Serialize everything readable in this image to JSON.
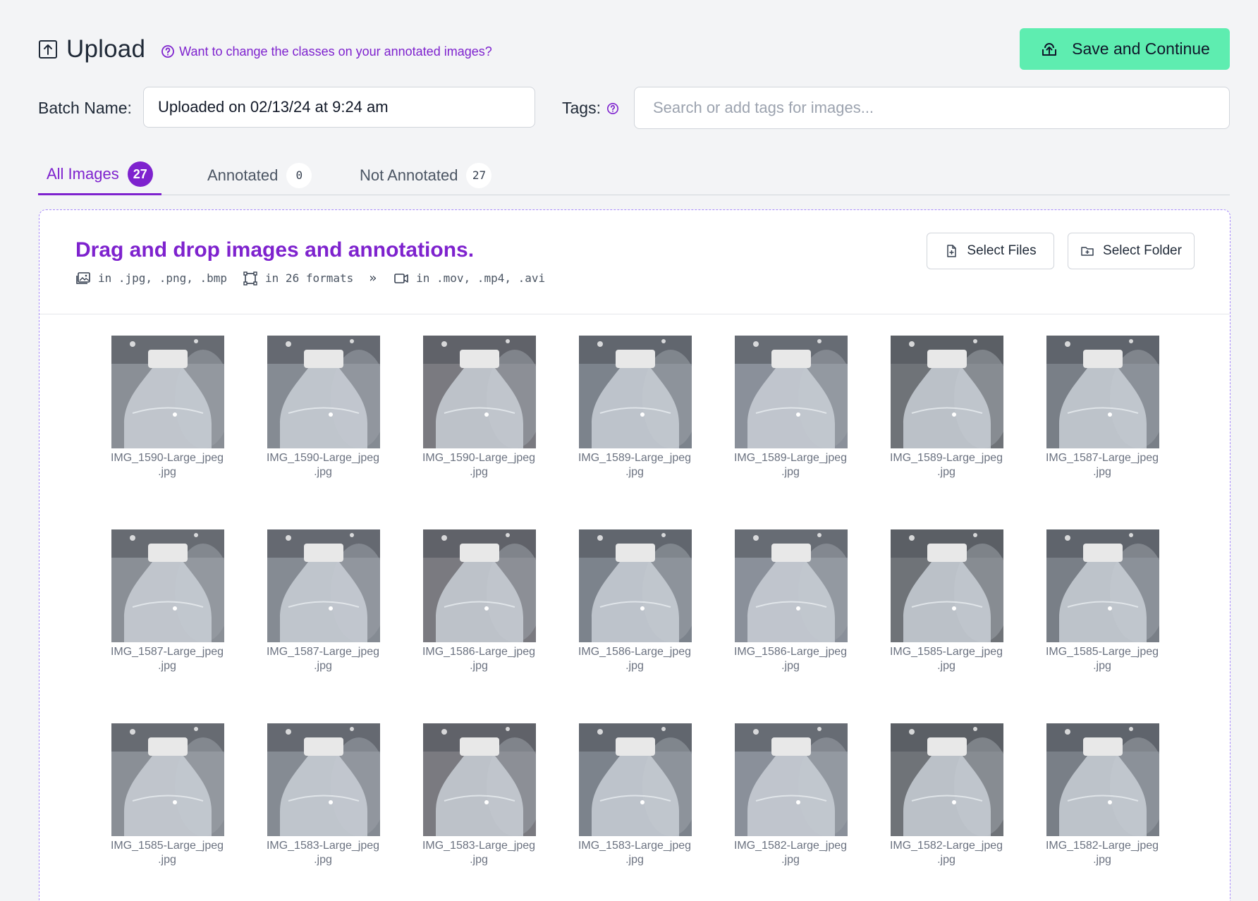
{
  "header": {
    "title": "Upload",
    "help_link": "Want to change the classes on your annotated images?",
    "save_button": "Save and Continue"
  },
  "batch": {
    "label": "Batch Name:",
    "value": "Uploaded on 02/13/24 at 9:24 am",
    "tags_label": "Tags:",
    "tags_placeholder": "Search or add tags for images..."
  },
  "tabs": [
    {
      "label": "All Images",
      "count": "27"
    },
    {
      "label": "Annotated",
      "count": "0"
    },
    {
      "label": "Not Annotated",
      "count": "27"
    }
  ],
  "dropzone": {
    "title": "Drag and drop images and annotations.",
    "formats": {
      "images": "in .jpg, .png, .bmp",
      "annotations": "in 26 formats",
      "videos": "in .mov, .mp4, .avi"
    },
    "select_files": "Select Files",
    "select_folder": "Select Folder"
  },
  "images": [
    {
      "name": "IMG_1590-Large_jpeg",
      "ext": ".jpg"
    },
    {
      "name": "IMG_1590-Large_jpeg",
      "ext": ".jpg"
    },
    {
      "name": "IMG_1590-Large_jpeg",
      "ext": ".jpg"
    },
    {
      "name": "IMG_1589-Large_jpeg",
      "ext": ".jpg"
    },
    {
      "name": "IMG_1589-Large_jpeg",
      "ext": ".jpg"
    },
    {
      "name": "IMG_1589-Large_jpeg",
      "ext": ".jpg"
    },
    {
      "name": "IMG_1587-Large_jpeg",
      "ext": ".jpg"
    },
    {
      "name": "IMG_1587-Large_jpeg",
      "ext": ".jpg"
    },
    {
      "name": "IMG_1587-Large_jpeg",
      "ext": ".jpg"
    },
    {
      "name": "IMG_1586-Large_jpeg",
      "ext": ".jpg"
    },
    {
      "name": "IMG_1586-Large_jpeg",
      "ext": ".jpg"
    },
    {
      "name": "IMG_1586-Large_jpeg",
      "ext": ".jpg"
    },
    {
      "name": "IMG_1585-Large_jpeg",
      "ext": ".jpg"
    },
    {
      "name": "IMG_1585-Large_jpeg",
      "ext": ".jpg"
    },
    {
      "name": "IMG_1585-Large_jpeg",
      "ext": ".jpg"
    },
    {
      "name": "IMG_1583-Large_jpeg",
      "ext": ".jpg"
    },
    {
      "name": "IMG_1583-Large_jpeg",
      "ext": ".jpg"
    },
    {
      "name": "IMG_1583-Large_jpeg",
      "ext": ".jpg"
    },
    {
      "name": "IMG_1582-Large_jpeg",
      "ext": ".jpg"
    },
    {
      "name": "IMG_1582-Large_jpeg",
      "ext": ".jpg"
    },
    {
      "name": "IMG_1582-Large_jpeg",
      "ext": ".jpg"
    }
  ],
  "colors": {
    "accent": "#7e22ce",
    "save": "#5eedb0"
  }
}
